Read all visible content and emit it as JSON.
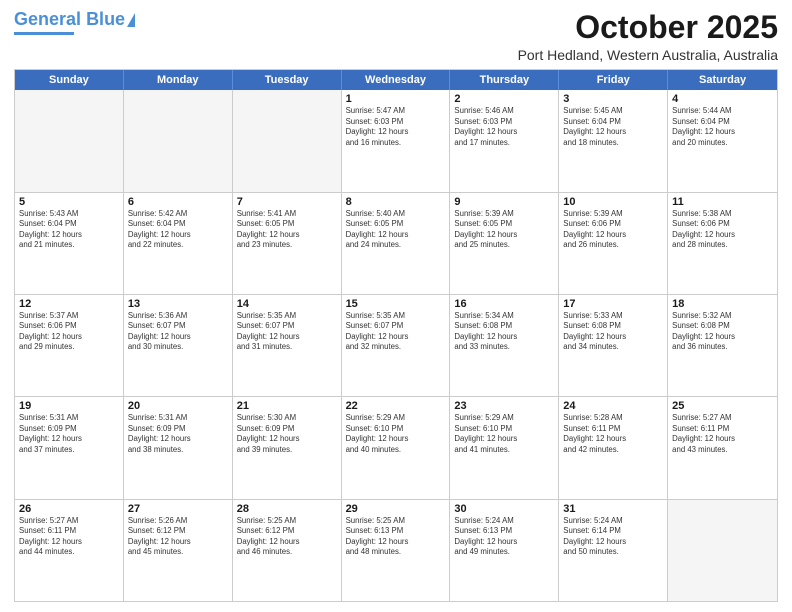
{
  "header": {
    "logo_general": "General",
    "logo_blue": "Blue",
    "month_title": "October 2025",
    "location": "Port Hedland, Western Australia, Australia"
  },
  "days_of_week": [
    "Sunday",
    "Monday",
    "Tuesday",
    "Wednesday",
    "Thursday",
    "Friday",
    "Saturday"
  ],
  "rows": [
    [
      {
        "day": "",
        "empty": true
      },
      {
        "day": "",
        "empty": true
      },
      {
        "day": "",
        "empty": true
      },
      {
        "day": "1",
        "sunrise": "5:47 AM",
        "sunset": "6:03 PM",
        "daylight": "12 hours and 16 minutes."
      },
      {
        "day": "2",
        "sunrise": "5:46 AM",
        "sunset": "6:03 PM",
        "daylight": "12 hours and 17 minutes."
      },
      {
        "day": "3",
        "sunrise": "5:45 AM",
        "sunset": "6:04 PM",
        "daylight": "12 hours and 18 minutes."
      },
      {
        "day": "4",
        "sunrise": "5:44 AM",
        "sunset": "6:04 PM",
        "daylight": "12 hours and 20 minutes."
      }
    ],
    [
      {
        "day": "5",
        "sunrise": "5:43 AM",
        "sunset": "6:04 PM",
        "daylight": "12 hours and 21 minutes."
      },
      {
        "day": "6",
        "sunrise": "5:42 AM",
        "sunset": "6:04 PM",
        "daylight": "12 hours and 22 minutes."
      },
      {
        "day": "7",
        "sunrise": "5:41 AM",
        "sunset": "6:05 PM",
        "daylight": "12 hours and 23 minutes."
      },
      {
        "day": "8",
        "sunrise": "5:40 AM",
        "sunset": "6:05 PM",
        "daylight": "12 hours and 24 minutes."
      },
      {
        "day": "9",
        "sunrise": "5:39 AM",
        "sunset": "6:05 PM",
        "daylight": "12 hours and 25 minutes."
      },
      {
        "day": "10",
        "sunrise": "5:39 AM",
        "sunset": "6:06 PM",
        "daylight": "12 hours and 26 minutes."
      },
      {
        "day": "11",
        "sunrise": "5:38 AM",
        "sunset": "6:06 PM",
        "daylight": "12 hours and 28 minutes."
      }
    ],
    [
      {
        "day": "12",
        "sunrise": "5:37 AM",
        "sunset": "6:06 PM",
        "daylight": "12 hours and 29 minutes."
      },
      {
        "day": "13",
        "sunrise": "5:36 AM",
        "sunset": "6:07 PM",
        "daylight": "12 hours and 30 minutes."
      },
      {
        "day": "14",
        "sunrise": "5:35 AM",
        "sunset": "6:07 PM",
        "daylight": "12 hours and 31 minutes."
      },
      {
        "day": "15",
        "sunrise": "5:35 AM",
        "sunset": "6:07 PM",
        "daylight": "12 hours and 32 minutes."
      },
      {
        "day": "16",
        "sunrise": "5:34 AM",
        "sunset": "6:08 PM",
        "daylight": "12 hours and 33 minutes."
      },
      {
        "day": "17",
        "sunrise": "5:33 AM",
        "sunset": "6:08 PM",
        "daylight": "12 hours and 34 minutes."
      },
      {
        "day": "18",
        "sunrise": "5:32 AM",
        "sunset": "6:08 PM",
        "daylight": "12 hours and 36 minutes."
      }
    ],
    [
      {
        "day": "19",
        "sunrise": "5:31 AM",
        "sunset": "6:09 PM",
        "daylight": "12 hours and 37 minutes."
      },
      {
        "day": "20",
        "sunrise": "5:31 AM",
        "sunset": "6:09 PM",
        "daylight": "12 hours and 38 minutes."
      },
      {
        "day": "21",
        "sunrise": "5:30 AM",
        "sunset": "6:09 PM",
        "daylight": "12 hours and 39 minutes."
      },
      {
        "day": "22",
        "sunrise": "5:29 AM",
        "sunset": "6:10 PM",
        "daylight": "12 hours and 40 minutes."
      },
      {
        "day": "23",
        "sunrise": "5:29 AM",
        "sunset": "6:10 PM",
        "daylight": "12 hours and 41 minutes."
      },
      {
        "day": "24",
        "sunrise": "5:28 AM",
        "sunset": "6:11 PM",
        "daylight": "12 hours and 42 minutes."
      },
      {
        "day": "25",
        "sunrise": "5:27 AM",
        "sunset": "6:11 PM",
        "daylight": "12 hours and 43 minutes."
      }
    ],
    [
      {
        "day": "26",
        "sunrise": "5:27 AM",
        "sunset": "6:11 PM",
        "daylight": "12 hours and 44 minutes."
      },
      {
        "day": "27",
        "sunrise": "5:26 AM",
        "sunset": "6:12 PM",
        "daylight": "12 hours and 45 minutes."
      },
      {
        "day": "28",
        "sunrise": "5:25 AM",
        "sunset": "6:12 PM",
        "daylight": "12 hours and 46 minutes."
      },
      {
        "day": "29",
        "sunrise": "5:25 AM",
        "sunset": "6:13 PM",
        "daylight": "12 hours and 48 minutes."
      },
      {
        "day": "30",
        "sunrise": "5:24 AM",
        "sunset": "6:13 PM",
        "daylight": "12 hours and 49 minutes."
      },
      {
        "day": "31",
        "sunrise": "5:24 AM",
        "sunset": "6:14 PM",
        "daylight": "12 hours and 50 minutes."
      },
      {
        "day": "",
        "empty": true
      }
    ]
  ]
}
